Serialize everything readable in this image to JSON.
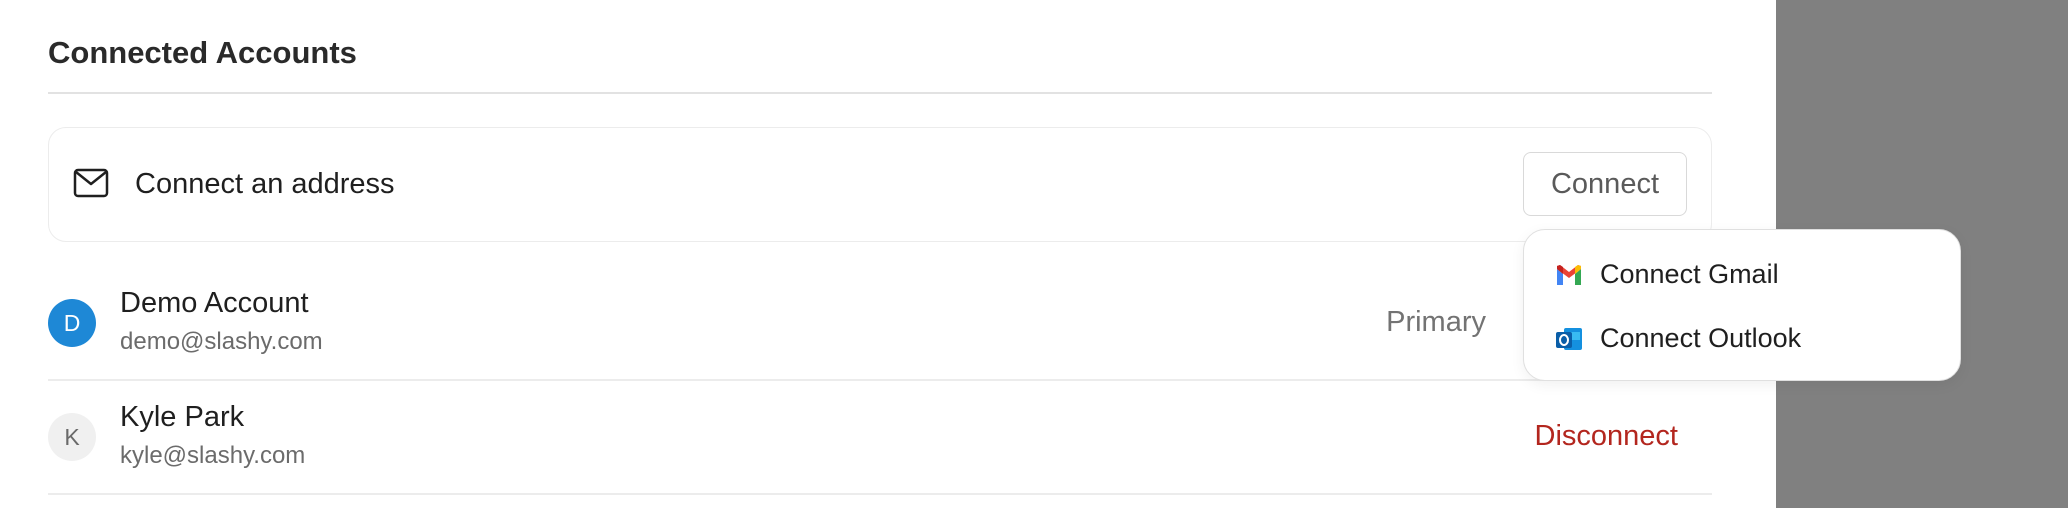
{
  "section": {
    "title": "Connected Accounts"
  },
  "connect_card": {
    "label": "Connect an address",
    "button_label": "Connect",
    "icon": "mail-icon"
  },
  "accounts": [
    {
      "initial": "D",
      "name": "Demo Account",
      "email": "demo@slashy.com",
      "status": "Primary",
      "avatar_color": "#1e88d6"
    },
    {
      "initial": "K",
      "name": "Kyle Park",
      "email": "kyle@slashy.com",
      "action": "Disconnect",
      "avatar_color": "#f0f0f0"
    }
  ],
  "dropdown": {
    "items": [
      {
        "label": "Connect Gmail",
        "icon": "gmail-icon"
      },
      {
        "label": "Connect Outlook",
        "icon": "outlook-icon"
      }
    ]
  },
  "colors": {
    "disconnect": "#b3261e",
    "side_panel": "#808080"
  }
}
